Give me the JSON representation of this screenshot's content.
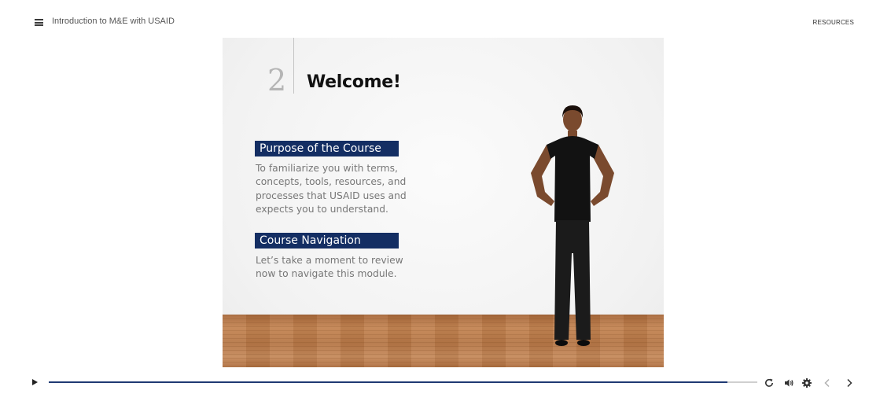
{
  "header": {
    "course_title": "Introduction to M&E with USAID",
    "resources_label": "RESOURCES"
  },
  "slide": {
    "number": "2",
    "title": "Welcome!",
    "sections": [
      {
        "heading": "Purpose of the Course",
        "lines": [
          "To familiarize you with terms,",
          "concepts, tools, resources, and",
          "processes that USAID uses and",
          "expects you to understand."
        ]
      },
      {
        "heading": "Course Navigation",
        "lines": [
          "Let’s take a moment to review",
          "now to navigate this module."
        ]
      }
    ]
  },
  "player": {
    "progress": 0.958,
    "accent_color": "#1f3a73",
    "banner_color": "#142e63"
  },
  "icons": [
    "menu-icon",
    "play-icon",
    "replay-icon",
    "volume-icon",
    "settings-icon",
    "prev-icon",
    "next-icon"
  ]
}
